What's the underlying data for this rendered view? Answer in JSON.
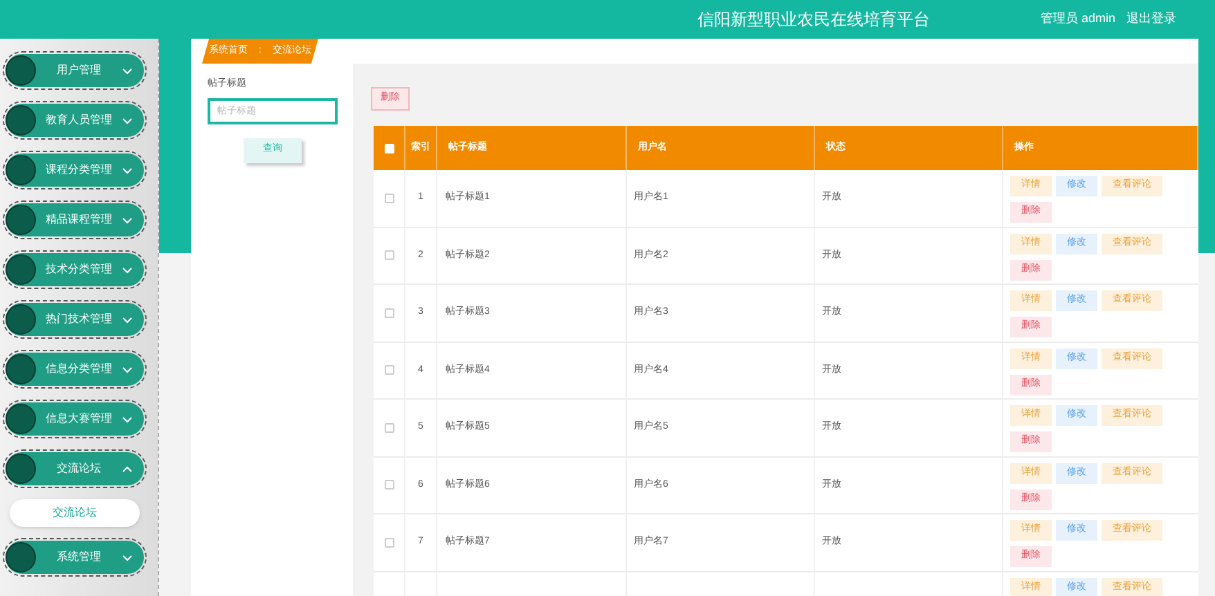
{
  "header": {
    "title": "信阳新型职业农民在线培育平台",
    "user": "管理员 admin",
    "logout": "退出登录"
  },
  "sidebar": {
    "items": [
      {
        "label": "用户管理",
        "expanded": false
      },
      {
        "label": "教育人员管理",
        "expanded": false
      },
      {
        "label": "课程分类管理",
        "expanded": false
      },
      {
        "label": "精品课程管理",
        "expanded": false
      },
      {
        "label": "技术分类管理",
        "expanded": false
      },
      {
        "label": "热门技术管理",
        "expanded": false
      },
      {
        "label": "信息分类管理",
        "expanded": false
      },
      {
        "label": "信息大赛管理",
        "expanded": false
      },
      {
        "label": "交流论坛",
        "expanded": true,
        "children": [
          {
            "label": "交流论坛"
          }
        ]
      },
      {
        "label": "系统管理",
        "expanded": false
      }
    ]
  },
  "breadcrumb": {
    "home": "系统首页",
    "separator": ":",
    "current": "交流论坛"
  },
  "filter": {
    "label": "帖子标题",
    "placeholder": "帖子标题",
    "search_button": "查询"
  },
  "delete_button": "删除",
  "table": {
    "columns": [
      "",
      "索引",
      "帖子标题",
      "用户名",
      "状态",
      "操作"
    ],
    "rows": [
      {
        "checked": false,
        "index": "1",
        "title": "帖子标题1",
        "user": "用户名1",
        "status": "开放",
        "actions": [
          "详情",
          "修改",
          "查看评论",
          "删除"
        ]
      },
      {
        "checked": false,
        "index": "2",
        "title": "帖子标题2",
        "user": "用户名2",
        "status": "开放",
        "actions": [
          "详情",
          "修改",
          "查看评论",
          "删除"
        ]
      },
      {
        "checked": false,
        "index": "3",
        "title": "帖子标题3",
        "user": "用户名3",
        "status": "开放",
        "actions": [
          "详情",
          "修改",
          "查看评论",
          "删除"
        ]
      },
      {
        "checked": false,
        "index": "4",
        "title": "帖子标题4",
        "user": "用户名4",
        "status": "开放",
        "actions": [
          "详情",
          "修改",
          "查看评论",
          "删除"
        ]
      },
      {
        "checked": false,
        "index": "5",
        "title": "帖子标题5",
        "user": "用户名5",
        "status": "开放",
        "actions": [
          "详情",
          "修改",
          "查看评论",
          "删除"
        ]
      },
      {
        "checked": false,
        "index": "6",
        "title": "帖子标题6",
        "user": "用户名6",
        "status": "开放",
        "actions": [
          "详情",
          "修改",
          "查看评论",
          "删除"
        ]
      },
      {
        "checked": false,
        "index": "7",
        "title": "帖子标题7",
        "user": "用户名7",
        "status": "开放",
        "actions": [
          "详情",
          "修改",
          "查看评论",
          "删除"
        ]
      },
      {
        "actions": [
          "详情",
          "修改",
          "查看评论"
        ]
      }
    ],
    "select_all_checked": false
  }
}
